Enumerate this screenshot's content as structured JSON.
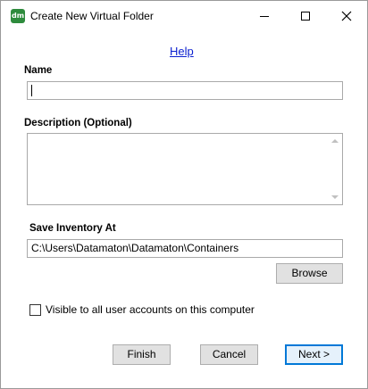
{
  "window": {
    "title": "Create New Virtual Folder",
    "app_icon_text": "dm"
  },
  "help_link": "Help",
  "name_field": {
    "label": "Name",
    "value": ""
  },
  "description_field": {
    "label": "Description (Optional)",
    "value": ""
  },
  "inventory": {
    "label": "Save Inventory At",
    "path": "C:\\Users\\Datamaton\\Datamaton\\Containers",
    "browse_label": "Browse"
  },
  "visibility_checkbox": {
    "label": "Visible to all user accounts on this computer",
    "checked": false
  },
  "footer": {
    "finish_label": "Finish",
    "cancel_label": "Cancel",
    "next_label": "Next >"
  },
  "colors": {
    "accent": "#0078d7",
    "link": "#0b1fcf",
    "app_icon": "#2e8b3d"
  }
}
